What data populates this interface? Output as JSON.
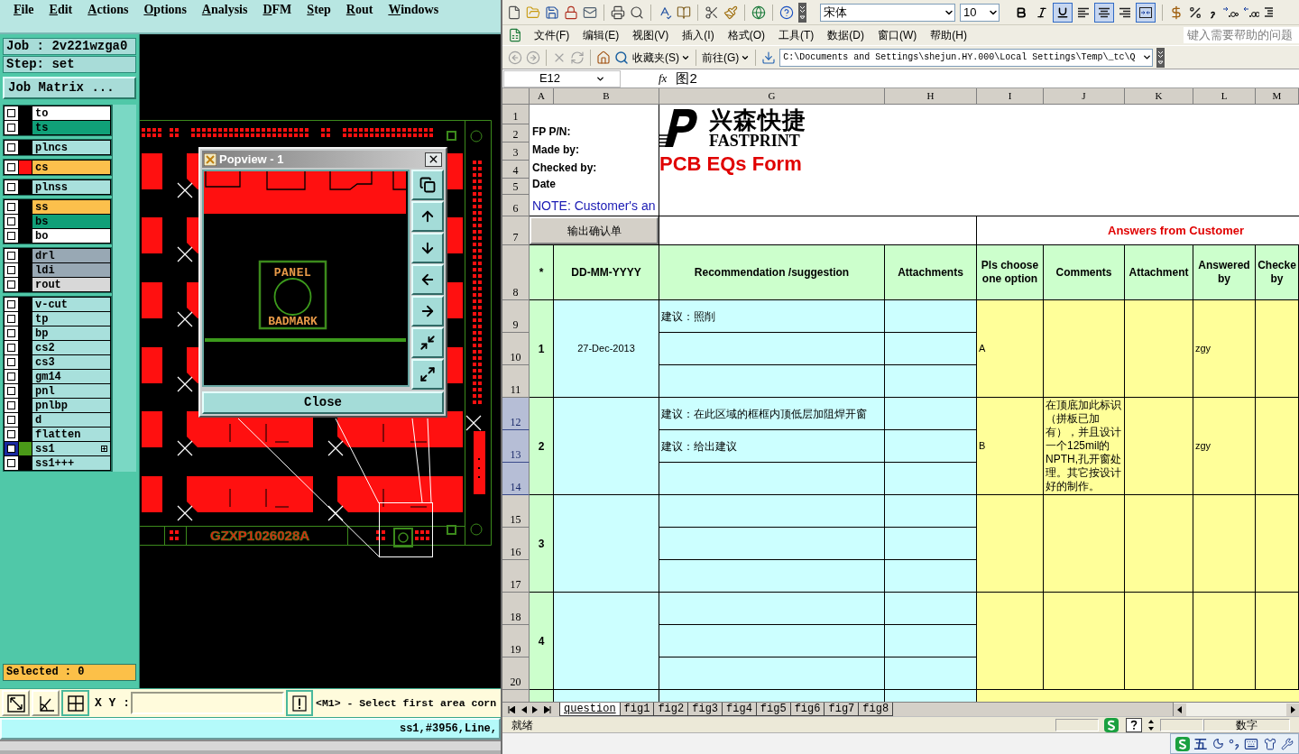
{
  "cam": {
    "menu": [
      "File",
      "Edit",
      "Actions",
      "Options",
      "Analysis",
      "DFM",
      "Step",
      "Rout",
      "Windows"
    ],
    "job": "Job : 2v221wzga0",
    "step": "Step: set",
    "matrix_button": "Job Matrix ...",
    "layer_groups": [
      {
        "layers": [
          {
            "name": "to",
            "color": "#ffffff",
            "checked": false,
            "selected": false
          },
          {
            "name": "ts",
            "color": "#10a078",
            "checked": false,
            "selected": false
          }
        ]
      },
      {
        "layers": [
          {
            "name": "plncs",
            "color": "#a8e0dc",
            "checked": false,
            "selected": false
          }
        ]
      },
      {
        "layers": [
          {
            "name": "cs",
            "color": "#fcc04c",
            "swatch": {
              "color": "#ff1010"
            },
            "checked": false,
            "selected": false
          }
        ]
      },
      {
        "layers": [
          {
            "name": "plnss",
            "color": "#a8e0dc",
            "checked": false,
            "selected": false
          }
        ]
      },
      {
        "layers": [
          {
            "name": "ss",
            "color": "#fcc04c",
            "checked": false,
            "selected": false
          },
          {
            "name": "bs",
            "color": "#10a078",
            "checked": false,
            "selected": false
          },
          {
            "name": "bo",
            "color": "#ffffff",
            "checked": false,
            "selected": false
          }
        ]
      },
      {
        "layers": [
          {
            "name": "drl",
            "color": "#98a8b4",
            "checked": false,
            "selected": false
          },
          {
            "name": "ldi",
            "color": "#98a8b4",
            "checked": false,
            "selected": false
          },
          {
            "name": "rout",
            "color": "#d8d8d8",
            "checked": false,
            "selected": false
          }
        ]
      },
      {
        "layers": [
          {
            "name": "v-cut",
            "color": "#a8e0dc",
            "checked": false,
            "selected": false
          },
          {
            "name": "tp",
            "color": "#a8e0dc",
            "checked": false,
            "selected": false
          },
          {
            "name": "bp",
            "color": "#a8e0dc",
            "checked": false,
            "selected": false
          },
          {
            "name": "cs2",
            "color": "#a8e0dc",
            "checked": false,
            "selected": false
          },
          {
            "name": "cs3",
            "color": "#a8e0dc",
            "checked": false,
            "selected": false
          },
          {
            "name": "gm14",
            "color": "#a8e0dc",
            "checked": false,
            "selected": false
          },
          {
            "name": "pnl",
            "color": "#a8e0dc",
            "checked": false,
            "selected": false
          },
          {
            "name": "pnlbp",
            "color": "#a8e0dc",
            "checked": false,
            "selected": false
          },
          {
            "name": "d",
            "color": "#a8e0dc",
            "checked": false,
            "selected": false
          },
          {
            "name": "flatten",
            "color": "#a8e0dc",
            "checked": false,
            "selected": false
          },
          {
            "name": "ss1",
            "color": "#a8e0dc",
            "swatch": {
              "color": "#4a9a18"
            },
            "checked": false,
            "selected": true
          },
          {
            "name": "ss1+++",
            "color": "#a8e0dc",
            "checked": false,
            "selected": false
          }
        ]
      }
    ],
    "selected_count": "Selected : 0",
    "board_label": "GZXP1026028A",
    "popview": {
      "title": "Popview - 1",
      "top_label": "PANEL",
      "bottom_label": "BADMARK",
      "close_button": "Close"
    },
    "tools": [
      {
        "kind": "diagonal",
        "selected": false
      },
      {
        "kind": "angle",
        "selected": false
      },
      {
        "kind": "grid",
        "selected": true
      }
    ],
    "coordinate_label": "X Y :",
    "prompt": "<M1> - Select first area corn",
    "status": "ss1,#3956,Line,"
  },
  "excel": {
    "font": "宋体",
    "font_size": "10",
    "format_buttons": [
      {
        "kind": "bold",
        "selected": false
      },
      {
        "kind": "italic",
        "selected": false
      },
      {
        "kind": "underline",
        "selected": true
      },
      {
        "kind": "align-left",
        "selected": false
      },
      {
        "kind": "align-center",
        "selected": true
      },
      {
        "kind": "align-right",
        "selected": false
      },
      {
        "kind": "merge",
        "selected": true
      }
    ],
    "menu": [
      "文件(F)",
      "编辑(E)",
      "视图(V)",
      "插入(I)",
      "格式(O)",
      "工具(T)",
      "数据(D)",
      "窗口(W)",
      "帮助(H)"
    ],
    "help_search": {
      "placeholder": "键入需要帮助的问题"
    },
    "web_toolbar": {
      "favorites": "收藏夹(S)",
      "go": "前往(G)",
      "address": "C:\\Documents and Settings\\shejun.HY.000\\Local Settings\\Temp\\_tc\\Q"
    },
    "name_box": "E12",
    "function_label": "fx",
    "formula": "图2",
    "columns": [
      {
        "label": "A",
        "selected": false
      },
      {
        "label": "B",
        "selected": false
      },
      {
        "label": "G",
        "selected": false
      },
      {
        "label": "H",
        "selected": false
      },
      {
        "label": "I",
        "selected": false
      },
      {
        "label": "J",
        "selected": false
      },
      {
        "label": "K",
        "selected": false
      },
      {
        "label": "L",
        "selected": false
      },
      {
        "label": "M",
        "selected": false
      }
    ],
    "top_rows": [
      {
        "number": "1",
        "selected": false
      },
      {
        "number": "2",
        "selected": false
      },
      {
        "number": "3",
        "selected": false
      },
      {
        "number": "4",
        "selected": false
      },
      {
        "number": "5",
        "selected": false
      },
      {
        "number": "6",
        "selected": false
      }
    ],
    "fields": [
      "FP P/N:",
      "Made by:",
      "Checked by:",
      "Date"
    ],
    "note": "NOTE: Customer's an",
    "logo": {
      "chinese": "兴森快捷",
      "english": "FASTPRINT"
    },
    "form_title": "PCB EQs Form",
    "row_7": {
      "number": "7",
      "selected": false,
      "export_button": "输出确认单",
      "answers_title": "Answers from Customer"
    },
    "row_8": {
      "number": "8",
      "selected": false,
      "headers": [
        "*",
        "DD-MM-YYYY",
        "Recommendation /suggestion",
        "Attachments",
        "Pls choose one option",
        "Comments",
        "Attachment",
        "Answered by",
        "Checke by"
      ]
    },
    "items": [
      {
        "no": "1",
        "date": "27-Dec-2013",
        "option": "A",
        "answered_by": "zgy",
        "rows": [
          {
            "number": "9",
            "selected": false,
            "suggestion": "建议：照削"
          },
          {
            "number": "10",
            "selected": false
          },
          {
            "number": "11",
            "selected": false
          }
        ]
      },
      {
        "no": "2",
        "option": "B",
        "comment": "在顶底加此标识（拼板已加有），并且设计一个125mil的NPTH,孔开窗处理。其它按设计好的制作。",
        "answered_by": "zgy",
        "rows": [
          {
            "number": "12",
            "selected": true,
            "suggestion": "建议：在此区域的框框内顶低层加阻焊开窗"
          },
          {
            "number": "13",
            "selected": true,
            "suggestion": "建议：给出建议"
          },
          {
            "number": "14",
            "selected": true
          }
        ]
      },
      {
        "no": "3",
        "rows": [
          {
            "number": "15",
            "selected": false
          },
          {
            "number": "16",
            "selected": false
          },
          {
            "number": "17",
            "selected": false
          }
        ]
      },
      {
        "no": "4",
        "rows": [
          {
            "number": "18",
            "selected": false
          },
          {
            "number": "19",
            "selected": false
          },
          {
            "number": "20",
            "selected": false
          }
        ]
      }
    ],
    "sheet_tabs": [
      {
        "label": "question",
        "selected": true
      },
      {
        "label": "fig1",
        "selected": false
      },
      {
        "label": "fig2",
        "selected": false
      },
      {
        "label": "fig3",
        "selected": false
      },
      {
        "label": "fig4",
        "selected": false
      },
      {
        "label": "fig5",
        "selected": false
      },
      {
        "label": "fig6",
        "selected": false
      },
      {
        "label": "fig7",
        "selected": false
      },
      {
        "label": "fig8",
        "selected": false
      }
    ],
    "status": "就绪",
    "keyboard_mode": "数字"
  },
  "taskbar": {
    "ime_mode": "五"
  }
}
